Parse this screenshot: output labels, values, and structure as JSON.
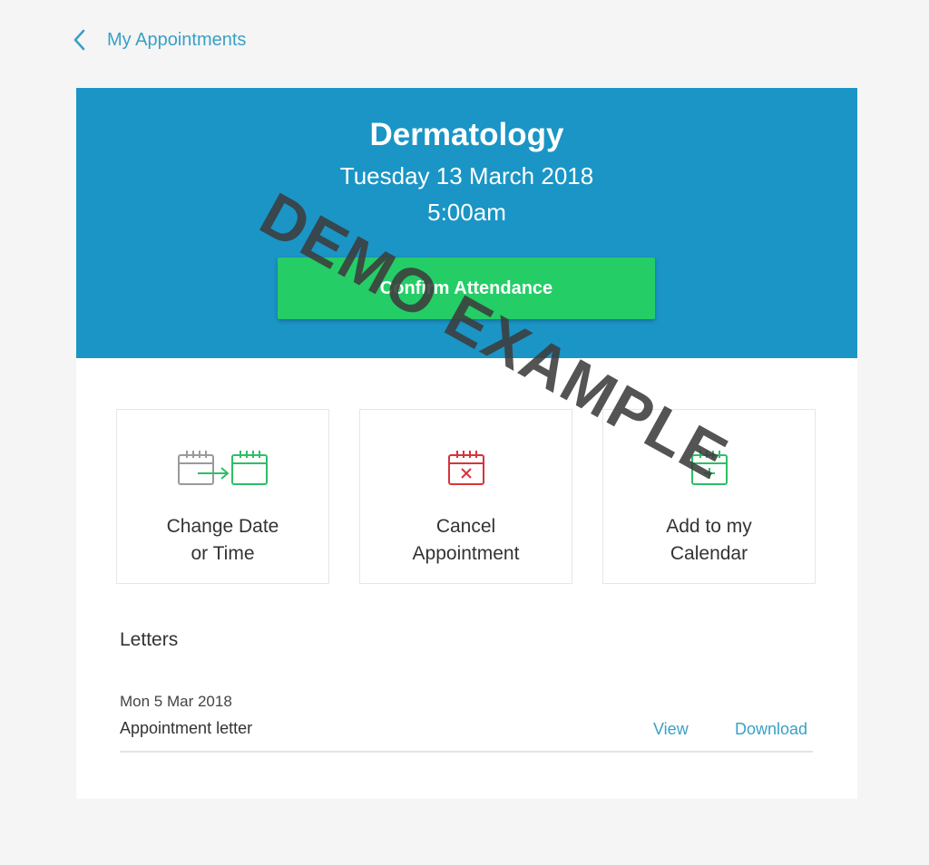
{
  "nav": {
    "back_label": "My Appointments"
  },
  "appointment": {
    "department": "Dermatology",
    "date": "Tuesday 13 March 2018",
    "time": "5:00am",
    "confirm_label": "Confirm Attendance"
  },
  "actions": [
    {
      "label_line1": "Change Date",
      "label_line2": "or Time",
      "icon": "calendar-change-icon"
    },
    {
      "label_line1": "Cancel",
      "label_line2": "Appointment",
      "icon": "calendar-cancel-icon"
    },
    {
      "label_line1": "Add to my",
      "label_line2": "Calendar",
      "icon": "calendar-add-icon"
    }
  ],
  "letters": {
    "heading": "Letters",
    "items": [
      {
        "date": "Mon 5 Mar 2018",
        "name": "Appointment letter",
        "view_label": "View",
        "download_label": "Download"
      }
    ]
  },
  "watermark": "DEMO EXAMPLE",
  "colors": {
    "accent": "#3aa0c6",
    "header_bg": "#1a95c6",
    "confirm_green": "#25cd67",
    "cancel_red": "#d9333a",
    "icon_green": "#2dbf66",
    "icon_gray": "#9a9a9a"
  }
}
